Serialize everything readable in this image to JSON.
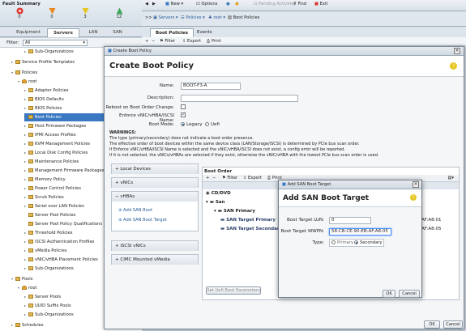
{
  "fault": {
    "title": "Fault Summary",
    "items": [
      {
        "count": "0",
        "icon": "critical-icon",
        "color": "#d9342b"
      },
      {
        "count": "0",
        "icon": "major-icon",
        "color": "#e8891b"
      },
      {
        "count": "3",
        "icon": "minor-icon",
        "color": "#e6c623"
      },
      {
        "count": "12",
        "icon": "warning-icon",
        "color": "#3ea65a"
      }
    ]
  },
  "nav": {
    "tabs": [
      "Equipment",
      "Servers",
      "LAN",
      "SAN"
    ],
    "active": "Servers",
    "filter_label": "Filter:",
    "filter_value": "All"
  },
  "tree": [
    "Sub-Organizations",
    "Service Profile Templates",
    "Policies",
    "root",
    "Adapter Policies",
    "BIOS Defaults",
    "BIOS Policies",
    "Boot Policies",
    "Host Firmware Packages",
    "IPMI Access Profiles",
    "KVM Management Policies",
    "Local Disk Config Policies",
    "Maintenance Policies",
    "Management Firmware Packages",
    "Memory Policy",
    "Power Control Policies",
    "Scrub Policies",
    "Serial over LAN Policies",
    "Server Pool Policies",
    "Server Pool Policy Qualifications",
    "Threshold Policies",
    "iSCSI Authentication Profiles",
    "vMedia Policies",
    "vNIC/vHBA Placement Policies",
    "Sub-Organizations",
    "Pools",
    "root",
    "Server Pools",
    "UUID Suffix Pools",
    "Sub-Organizations",
    "Schedules"
  ],
  "topbar": {
    "new": "New",
    "options": "Options",
    "pending": "Pending Activities",
    "find": "Find",
    "exit": "Exit"
  },
  "breadcrumb": {
    "servers": "Servers",
    "policies": "Policies",
    "root": "root",
    "current": "Boot Policies"
  },
  "right_tabs": [
    "Boot Policies",
    "Events"
  ],
  "right_tool": {
    "filter": "Filter",
    "export": "Export",
    "print": "Print"
  },
  "dialog": {
    "window_title": "Create Boot Policy",
    "heading": "Create Boot Policy",
    "name_label": "Name:",
    "name_value": "BOOT-F3-A",
    "description_label": "Description:",
    "description_value": "",
    "reboot_label": "Reboot on Boot Order Change:",
    "enforce_label": "Enforce vNIC/vHBA/iSCSI Name:",
    "bootmode_label": "Boot Mode:",
    "bootmode_legacy": "Legacy",
    "bootmode_uefi": "Uefi",
    "warnings_title": "WARNINGS:",
    "warnings": [
      "The type (primary/secondary) does not indicate a boot order presence.",
      "The effective order of boot devices within the same device class (LAN/Storage/iSCSI) is determined by PCIe bus scan order.",
      "If Enforce vNIC/vHBA/iSCSI Name is selected and the vNIC/vHBA/iSCSI does not exist, a config error will be reported.",
      "If it is not selected, the vNICs/vHBAs are selected if they exist, otherwise the vNIC/vHBA with the lowest PCIe bus scan order is used."
    ],
    "sections": {
      "local": "Local Devices",
      "vnics": "vNICs",
      "vhbas": "vHBAs",
      "add_san_boot": "Add SAN Boot",
      "add_san_boot_target": "Add SAN Boot Target",
      "iscsi": "iSCSI vNICs",
      "cimc": "CIMC Mounted vMedia"
    },
    "boot_order": {
      "title": "Boot Order",
      "filter": "Filter",
      "export": "Export",
      "print": "Print",
      "rows": [
        "CD/DVD",
        "San",
        "SAN Primary",
        "SAN Target Primary",
        "SAN Target Secondary"
      ],
      "wwn_suffix_1": "AF:A8:01",
      "wwn_suffix_2": "AF:A8:05",
      "set_uefi": "Set Uefi Boot Parameters"
    },
    "ok": "OK",
    "cancel": "Cancel"
  },
  "san_modal": {
    "window_title": "Add SAN Boot Target",
    "heading": "Add SAN Boot Target",
    "lun_label": "Boot Target LUN:",
    "lun_value": "0",
    "wwpn_label": "Boot Target WWPN:",
    "wwpn_value": "58:CB:CE:90:EB:AF:A8:05",
    "type_label": "Type:",
    "primary": "Primary",
    "secondary": "Secondary",
    "ok": "OK",
    "cancel": "Cancel"
  }
}
